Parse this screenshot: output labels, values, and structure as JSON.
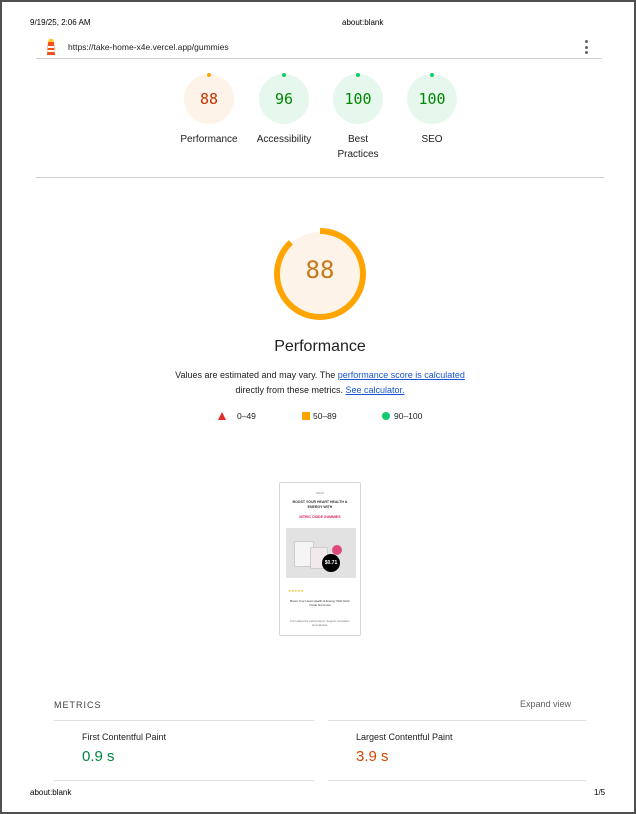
{
  "print_header": {
    "datetime": "9/19/25, 2:06 AM",
    "title": "about:blank"
  },
  "print_footer": {
    "url": "about:blank",
    "page": "1/5"
  },
  "toolbar": {
    "url": "https://take-home-x4e.vercel.app/gummies",
    "menu_icon": "kebab-menu-icon",
    "logo_icon": "lighthouse-icon"
  },
  "gauges": [
    {
      "score": "88",
      "label": "Performance",
      "status": "average"
    },
    {
      "score": "96",
      "label": "Accessibility",
      "status": "pass"
    },
    {
      "score": "100",
      "label": "Best Practices",
      "status": "pass"
    },
    {
      "score": "100",
      "label": "SEO",
      "status": "pass"
    }
  ],
  "performance": {
    "score": "88",
    "score_fraction": 0.88,
    "title": "Performance",
    "desc_prefix": "Values are estimated and may vary. The ",
    "desc_link1": "performance score is calculated",
    "desc_middle": " directly from these metrics. ",
    "desc_link2": "See calculator."
  },
  "legend": {
    "fail": "0–49",
    "average": "50–89",
    "pass": "90–100"
  },
  "screenshot": {
    "brand": "SNAP",
    "headline": "BOOST YOUR HEART HEALTH & ENERGY WITH",
    "headline_accent": "NITRIC OXIDE GUMMIES",
    "price_badge": "$0.71",
    "stars": "★★★★★",
    "caption": "Boost Your Heart Health & Energy With Nitric Oxide Gummies",
    "fineprint": "Formulated for performance. Support circulation and stamina."
  },
  "metrics": {
    "header": "METRICS",
    "expand_label": "Expand view",
    "items": [
      {
        "label": "First Contentful Paint",
        "value": "0.9 s",
        "status": "pass"
      },
      {
        "label": "Largest Contentful Paint",
        "value": "3.9 s",
        "status": "average"
      }
    ]
  },
  "colors": {
    "pass": "#0cce6b",
    "average": "#ffa400",
    "fail": "#ff4e42",
    "link": "#1a55d1"
  }
}
